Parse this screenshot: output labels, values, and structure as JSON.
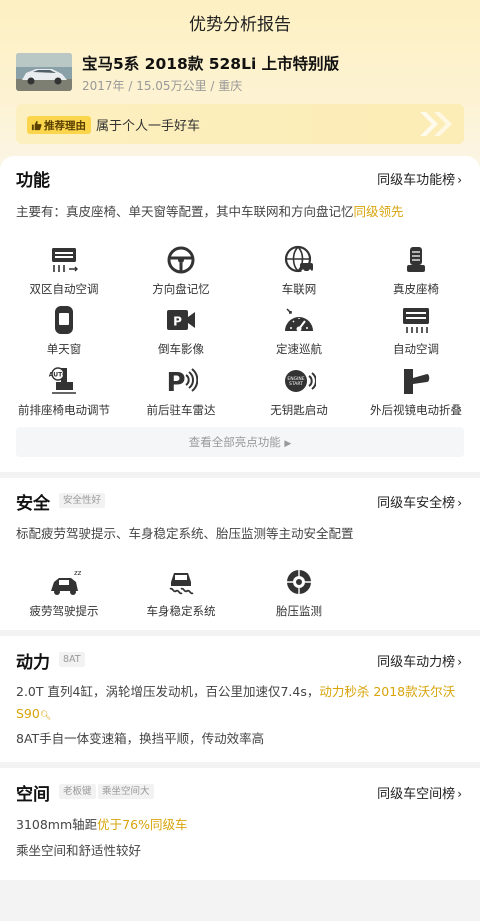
{
  "header": {
    "title": "优势分析报告",
    "car_name": "宝马5系 2018款 528Li 上市特别版",
    "car_meta": "2017年 / 15.05万公里 / 重庆",
    "reason_tag": "推荐理由",
    "reason_text": "属于个人一手好车"
  },
  "features": {
    "title": "功能",
    "link": "同级车功能榜",
    "desc_prefix": "主要有：真皮座椅、单天窗等配置，其中车联网和方向盘记忆",
    "desc_highlight": "同级领先",
    "items": [
      {
        "label": "双区自动空调",
        "icon": "dual-zone-ac-icon"
      },
      {
        "label": "方向盘记忆",
        "icon": "steering-wheel-icon"
      },
      {
        "label": "车联网",
        "icon": "connected-car-icon"
      },
      {
        "label": "真皮座椅",
        "icon": "leather-seat-icon"
      },
      {
        "label": "单天窗",
        "icon": "sunroof-icon"
      },
      {
        "label": "倒车影像",
        "icon": "reverse-camera-icon"
      },
      {
        "label": "定速巡航",
        "icon": "cruise-control-icon"
      },
      {
        "label": "自动空调",
        "icon": "auto-ac-icon"
      },
      {
        "label": "前排座椅电动调节",
        "icon": "power-seat-icon"
      },
      {
        "label": "前后驻车雷达",
        "icon": "parking-radar-icon"
      },
      {
        "label": "无钥匙启动",
        "icon": "keyless-start-icon"
      },
      {
        "label": "外后视镜电动折叠",
        "icon": "mirror-fold-icon"
      }
    ],
    "more": "查看全部亮点功能"
  },
  "safety": {
    "title": "安全",
    "tag": "安全性好",
    "link": "同级车安全榜",
    "desc": "标配疲劳驾驶提示、车身稳定系统、胎压监测等主动安全配置",
    "items": [
      {
        "label": "疲劳驾驶提示",
        "icon": "fatigue-alert-icon"
      },
      {
        "label": "车身稳定系统",
        "icon": "stability-control-icon"
      },
      {
        "label": "胎压监测",
        "icon": "tire-pressure-icon"
      }
    ]
  },
  "power": {
    "title": "动力",
    "tag": "8AT",
    "link": "同级车动力榜",
    "desc1_prefix": "2.0T 直列4缸，涡轮增压发动机，百公里加速仅7.4s，",
    "desc1_highlight": "动力秒杀 2018款沃尔沃S90",
    "desc2": "8AT手自一体变速箱，换挡平顺，传动效率高"
  },
  "space": {
    "title": "空间",
    "tag1": "老板键",
    "tag2": "乘坐空间大",
    "link": "同级车空间榜",
    "desc1_prefix": "3108mm轴距",
    "desc1_highlight": "优于76%同级车",
    "desc2": "乘坐空间和舒适性较好"
  },
  "colors": {
    "accent": "#d8a40a",
    "tag_yellow": "#fbd54b",
    "header_bg": "#fdf0c2"
  }
}
